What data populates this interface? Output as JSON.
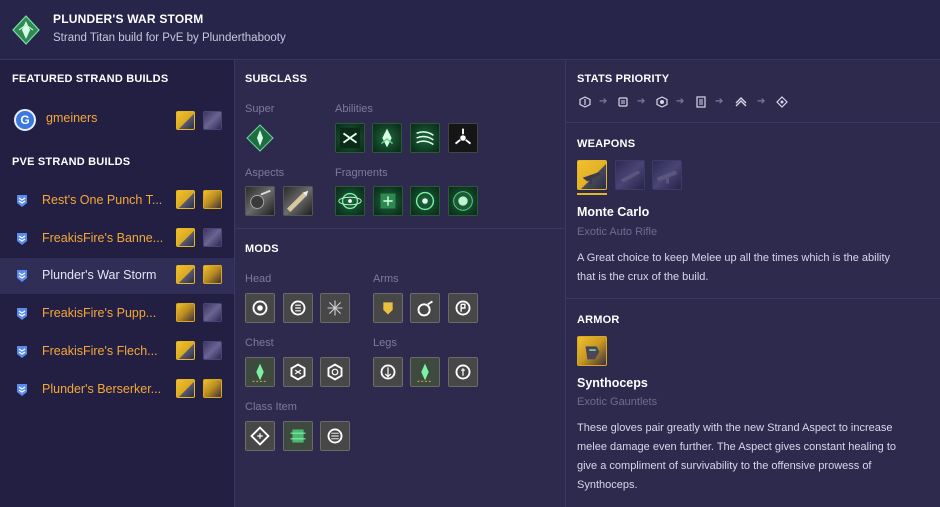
{
  "header": {
    "title": "PLUNDER'S WAR STORM",
    "subtitle": "Strand Titan build for PvE by Plunderthabooty",
    "emblem_icon": "strand-emblem-icon"
  },
  "sidebar": {
    "featured_title": "FEATURED STRAND BUILDS",
    "featured": [
      {
        "name": "gmeiners",
        "icon": "g-avatar-icon"
      }
    ],
    "pve_title": "PVE STRAND BUILDS",
    "builds": [
      {
        "name": "Rest's One Punch T...",
        "active": false
      },
      {
        "name": "FreakisFire's Banne...",
        "active": false
      },
      {
        "name": "Plunder's War Storm",
        "active": true
      },
      {
        "name": "FreakisFire's Pupp...",
        "active": false
      },
      {
        "name": "FreakisFire's Flech...",
        "active": false
      },
      {
        "name": "Plunder's Berserker...",
        "active": false
      }
    ]
  },
  "subclass": {
    "title": "SUBCLASS",
    "super_label": "Super",
    "abilities_label": "Abilities",
    "aspects_label": "Aspects",
    "fragments_label": "Fragments"
  },
  "mods": {
    "title": "MODS",
    "head_label": "Head",
    "arms_label": "Arms",
    "chest_label": "Chest",
    "legs_label": "Legs",
    "class_item_label": "Class Item"
  },
  "stats": {
    "title": "STATS PRIORITY",
    "order": [
      "resilience",
      "strength",
      "recovery",
      "discipline",
      "mobility",
      "intellect"
    ]
  },
  "weapons": {
    "title": "WEAPONS",
    "name": "Monte Carlo",
    "type": "Exotic Auto Rifle",
    "desc_line1": "A Great choice to keep Melee up all the times which is the ability",
    "desc_line2": "that is the crux of the build."
  },
  "armor": {
    "title": "ARMOR",
    "name": "Synthoceps",
    "type": "Exotic Gauntlets",
    "desc_line1": "These gloves pair greatly with the new Strand Aspect to increase",
    "desc_line2": "melee damage even further. The Aspect gives constant healing to",
    "desc_line3": "give a compliment of survivability to the offensive prowess of",
    "desc_line4": "Synthoceps."
  },
  "colors": {
    "accent": "#f4a83a",
    "background": "#2d2a4e",
    "sidebar": "#221f42",
    "strand_green": "#1e6a3e"
  }
}
